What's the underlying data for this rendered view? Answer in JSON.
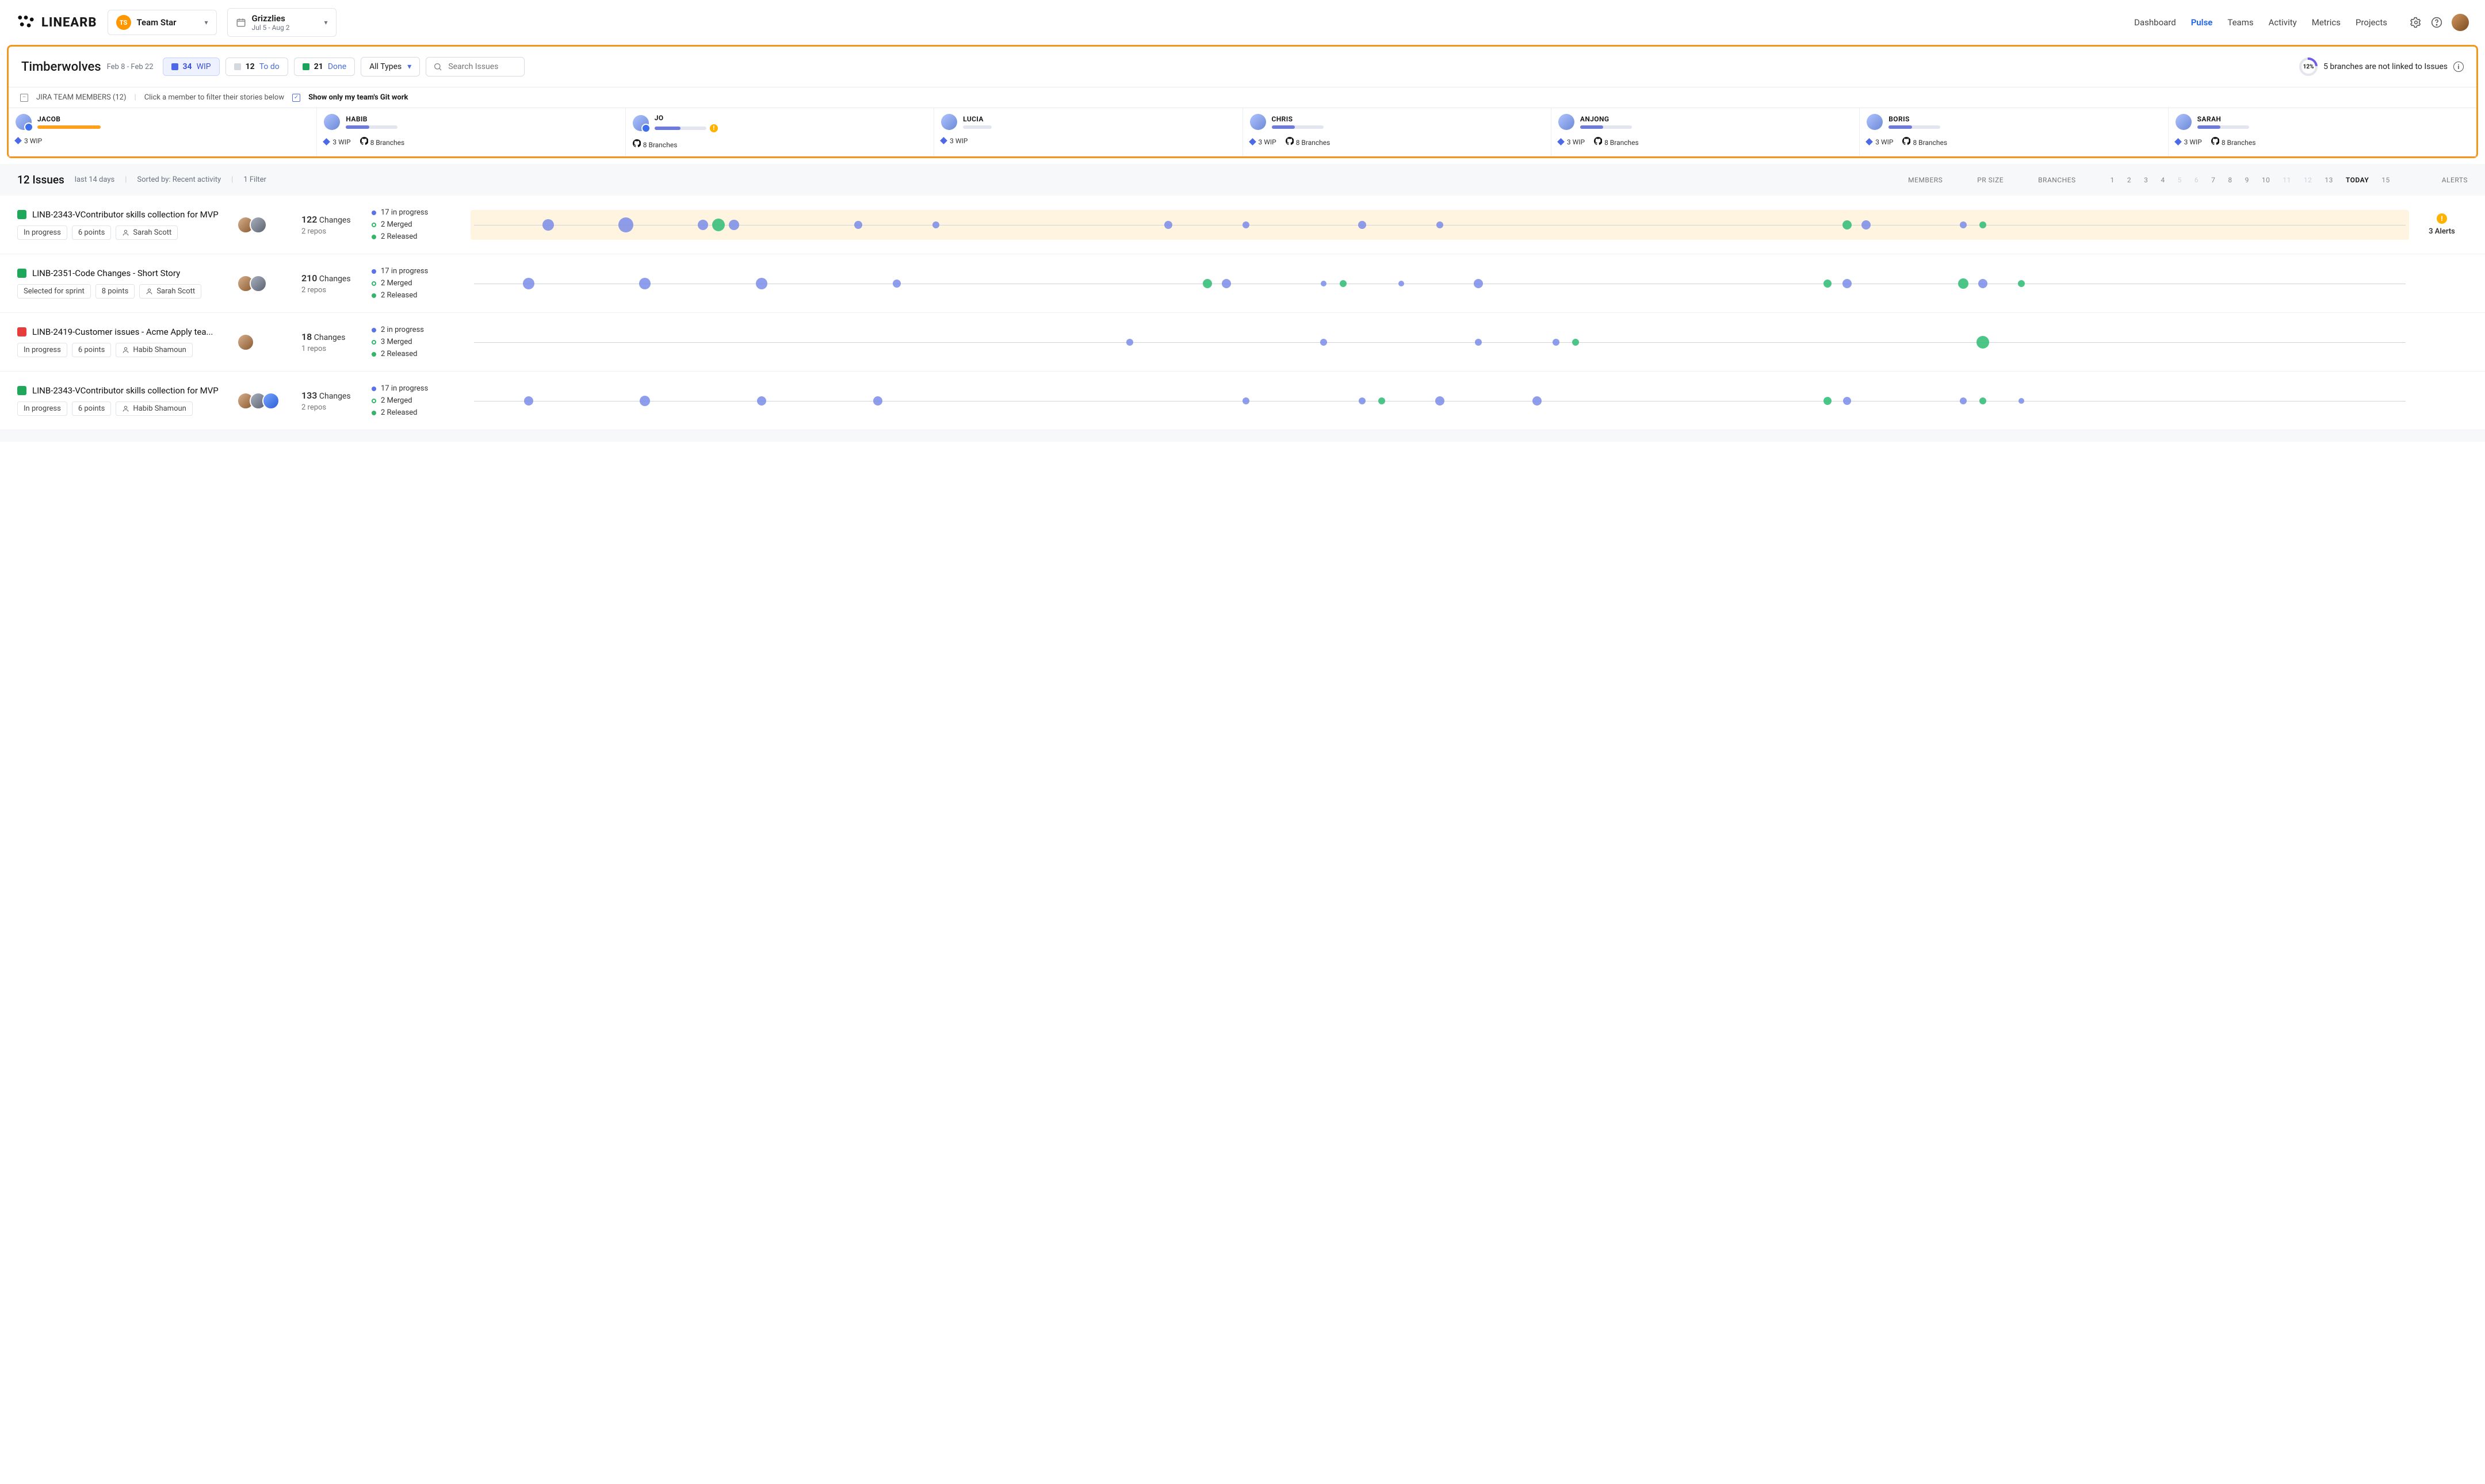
{
  "brand": "LINEARB",
  "team_selector": {
    "badge": "TS",
    "label": "Team Star"
  },
  "sprint_selector": {
    "title": "Grizzlies",
    "range": "Jul 5 - Aug 2"
  },
  "nav": {
    "items": [
      "Dashboard",
      "Pulse",
      "Teams",
      "Activity",
      "Metrics",
      "Projects"
    ],
    "active": "Pulse"
  },
  "page": {
    "title": "Timberwolves",
    "date_range": "Feb 8 - Feb 22"
  },
  "status_pills": {
    "wip": {
      "count": "34",
      "label": "WIP"
    },
    "todo": {
      "count": "12",
      "label": "To do"
    },
    "done": {
      "count": "21",
      "label": "Done"
    }
  },
  "type_filter": "All Types",
  "search_placeholder": "Search Issues",
  "branches_banner": {
    "percent": "12%",
    "text": "5 branches are not linked to Issues"
  },
  "members_header": {
    "label": "JIRA TEAM MEMBERS (12)",
    "hint": "Click a member to filter their stories below",
    "checkbox_label": "Show only my team's Git work"
  },
  "members": [
    {
      "name": "JACOB",
      "wip": "3 WIP",
      "branches": "",
      "bar_style": "orange-full",
      "badge": "info"
    },
    {
      "name": "HABIB",
      "wip": "3 WIP",
      "branches": "8 Branches",
      "bar_style": "",
      "badge": ""
    },
    {
      "name": "JO",
      "wip": "",
      "branches": "8 Branches",
      "bar_style": "warn",
      "badge": "info"
    },
    {
      "name": "LUCIA",
      "wip": "3 WIP",
      "branches": "",
      "bar_style": "short",
      "badge": ""
    },
    {
      "name": "CHRIS",
      "wip": "3 WIP",
      "branches": "8 Branches",
      "bar_style": "",
      "badge": ""
    },
    {
      "name": "ANJONG",
      "wip": "3 WIP",
      "branches": "8 Branches",
      "bar_style": "",
      "badge": ""
    },
    {
      "name": "BORIS",
      "wip": "3 WIP",
      "branches": "8 Branches",
      "bar_style": "",
      "badge": ""
    },
    {
      "name": "SARAH",
      "wip": "3 WIP",
      "branches": "8 Branches",
      "bar_style": "",
      "badge": ""
    }
  ],
  "issues_header": {
    "count": "12 Issues",
    "range": "last 14 days",
    "sorted": "Sorted by: Recent activity",
    "filter": "1 Filter",
    "col_members": "MEMBERS",
    "col_pr": "PR SIZE",
    "col_branches": "BRANCHES",
    "col_alerts": "ALERTS",
    "days": [
      "1",
      "2",
      "3",
      "4",
      "5",
      "6",
      "7",
      "8",
      "9",
      "10",
      "11",
      "12",
      "13",
      "TODAY",
      "15"
    ],
    "dim_days": [
      "5",
      "6",
      "11",
      "12"
    ]
  },
  "issues": [
    {
      "icon": "green",
      "title": "LINB-2343-VContributor skills collection for MVP",
      "tags": [
        "In progress",
        "6 points"
      ],
      "assignee": "Sarah Scott",
      "member_avatars": 2,
      "changes": "122",
      "changes_label": "Changes",
      "repos": "2 repos",
      "branches": [
        [
          "blue",
          "17 in progress"
        ],
        [
          "green-o",
          "2 Merged"
        ],
        [
          "green-f",
          "2 Released"
        ]
      ],
      "highlight": true,
      "alerts": "3 Alerts",
      "bubbles": [
        [
          "b",
          4,
          20
        ],
        [
          "b",
          8,
          26
        ],
        [
          "b",
          12,
          18
        ],
        [
          "g",
          12.8,
          22
        ],
        [
          "b",
          13.6,
          18
        ],
        [
          "b",
          20,
          14
        ],
        [
          "b",
          24,
          12
        ],
        [
          "b",
          36,
          14
        ],
        [
          "b",
          40,
          12
        ],
        [
          "b",
          46,
          14
        ],
        [
          "b",
          50,
          12
        ],
        [
          "g",
          71,
          16
        ],
        [
          "b",
          72,
          16
        ],
        [
          "b",
          77,
          12
        ],
        [
          "g",
          78,
          12
        ]
      ]
    },
    {
      "icon": "green",
      "title": "LINB-2351-Code Changes - Short Story",
      "tags": [
        "Selected for sprint",
        "8 points"
      ],
      "assignee": "Sarah Scott",
      "member_avatars": 2,
      "changes": "210",
      "changes_label": "Changes",
      "repos": "2 repos",
      "branches": [
        [
          "blue",
          "17 in progress"
        ],
        [
          "green-o",
          "2 Merged"
        ],
        [
          "green-f",
          "2 Released"
        ]
      ],
      "highlight": false,
      "alerts": "",
      "bubbles": [
        [
          "b",
          3,
          20
        ],
        [
          "b",
          9,
          20
        ],
        [
          "b",
          15,
          20
        ],
        [
          "b",
          22,
          14
        ],
        [
          "g",
          38,
          16
        ],
        [
          "b",
          39,
          16
        ],
        [
          "b",
          44,
          10
        ],
        [
          "g",
          45,
          12
        ],
        [
          "b",
          48,
          10
        ],
        [
          "b",
          52,
          16
        ],
        [
          "g",
          70,
          14
        ],
        [
          "b",
          71,
          16
        ],
        [
          "g",
          77,
          18
        ],
        [
          "b",
          78,
          16
        ],
        [
          "g",
          80,
          12
        ]
      ]
    },
    {
      "icon": "red",
      "title": "LINB-2419-Customer issues - Acme Apply tea...",
      "tags": [
        "In progress",
        "6 points"
      ],
      "assignee": "Habib Shamoun",
      "member_avatars": 1,
      "changes": "18",
      "changes_label": "Changes",
      "repos": "1 repos",
      "branches": [
        [
          "blue",
          "2 in progress"
        ],
        [
          "green-o",
          "3 Merged"
        ],
        [
          "green-f",
          "2 Released"
        ]
      ],
      "highlight": false,
      "alerts": "",
      "bubbles": [
        [
          "b",
          34,
          12
        ],
        [
          "b",
          44,
          12
        ],
        [
          "b",
          52,
          12
        ],
        [
          "b",
          56,
          12
        ],
        [
          "g",
          57,
          12
        ],
        [
          "g",
          78,
          22
        ]
      ]
    },
    {
      "icon": "green",
      "title": "LINB-2343-VContributor skills collection for MVP",
      "tags": [
        "In progress",
        "6 points"
      ],
      "assignee": "Habib Shamoun",
      "member_avatars": 3,
      "changes": "133",
      "changes_label": "Changes",
      "repos": "2 repos",
      "branches": [
        [
          "blue",
          "17 in progress"
        ],
        [
          "green-o",
          "2 Merged"
        ],
        [
          "green-f",
          "2 Released"
        ]
      ],
      "highlight": false,
      "alerts": "",
      "bubbles": [
        [
          "b",
          3,
          16
        ],
        [
          "b",
          9,
          18
        ],
        [
          "b",
          15,
          16
        ],
        [
          "b",
          21,
          16
        ],
        [
          "b",
          40,
          12
        ],
        [
          "b",
          46,
          12
        ],
        [
          "g",
          47,
          12
        ],
        [
          "b",
          50,
          16
        ],
        [
          "b",
          55,
          16
        ],
        [
          "g",
          70,
          14
        ],
        [
          "b",
          71,
          14
        ],
        [
          "b",
          77,
          12
        ],
        [
          "g",
          78,
          12
        ],
        [
          "b",
          80,
          10
        ]
      ]
    }
  ]
}
